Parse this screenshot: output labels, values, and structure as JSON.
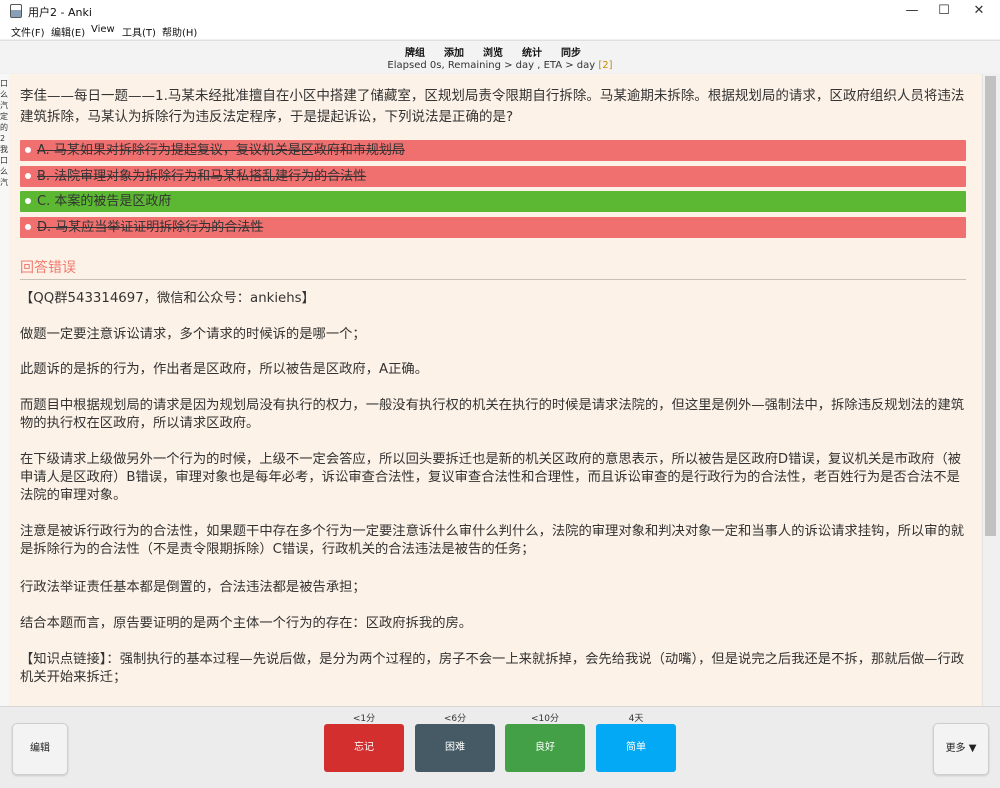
{
  "window": {
    "title": "用户2 - Anki",
    "minimize": "—",
    "maximize": "☐",
    "close": "✕"
  },
  "menu": [
    "文件(F)",
    "编辑(E)",
    "View",
    "工具(T)",
    "帮助(H)"
  ],
  "toolbar": [
    "牌组",
    "添加",
    "浏览",
    "统计",
    "同步"
  ],
  "status": {
    "text": "Elapsed 0s, Remaining > day , ETA > day",
    "badge": "[2]"
  },
  "side_strip_text": "口\n么\n汽\n定\n的\n2\n我\n口\n么\n汽",
  "question": "李佳——每日一题——1.马某未经批准擅自在小区中搭建了储藏室，区规划局责令限期自行拆除。马某逾期未拆除。根据规划局的请求，区政府组织人员将违法建筑拆除，马某认为拆除行为违反法定程序，于是提起诉讼，下列说法是正确的是?",
  "options": [
    {
      "text": "A. 马某如果对拆除行为提起复议，复议机关是区政府和市规划局",
      "state": "wrong"
    },
    {
      "text": "B. 法院审理对象为拆除行为和马某私搭乱建行为的合法性",
      "state": "wrong"
    },
    {
      "text": "C. 本案的被告是区政府",
      "state": "right"
    },
    {
      "text": "D. 马某应当举证证明拆除行为的合法性",
      "state": "wrong"
    }
  ],
  "result": "回答错误",
  "explanation": [
    "【QQ群543314697，微信和公众号：ankiehs】",
    "做题一定要注意诉讼请求，多个请求的时候诉的是哪一个；",
    "此题诉的是拆的行为，作出者是区政府，所以被告是区政府，A正确。",
    "而题目中根据规划局的请求是因为规划局没有执行的权力，一般没有执行权的机关在执行的时候是请求法院的，但这里是例外—强制法中，拆除违反规划法的建筑物的执行权在区政府，所以请求区政府。",
    "在下级请求上级做另外一个行为的时候，上级不一定会答应，所以回头要拆迁也是新的机关区政府的意思表示，所以被告是区政府D错误，复议机关是市政府（被申请人是区政府）B错误，审理对象也是每年必考，诉讼审查合法性，复议审查合法性和合理性，而且诉讼审查的是行政行为的合法性，老百姓行为是否合法不是法院的审理对象。",
    "注意是被诉行政行为的合法性，如果题干中存在多个行为一定要注意诉什么审什么判什么，法院的审理对象和判决对象一定和当事人的诉讼请求挂钩，所以审的就是拆除行为的合法性（不是责令限期拆除）C错误，行政机关的合法违法是被告的任务；",
    "行政法举证责任基本都是倒置的，合法违法都是被告承担；",
    "结合本题而言，原告要证明的是两个主体一个行为的存在：区政府拆我的房。",
    "【知识点链接】：强制执行的基本过程—先说后做，是分为两个过程的，房子不会一上来就拆掉，会先给我说（动嘴），但是说完之后我还是不拆，那就后做—行政机关开始来拆迁；"
  ],
  "bottom": {
    "edit": "编辑",
    "more": "更多 ▼",
    "buttons": [
      {
        "label": "忘记",
        "time": "<1分",
        "color": "#d32f2f"
      },
      {
        "label": "困难",
        "time": "<6分",
        "color": "#455a64"
      },
      {
        "label": "良好",
        "time": "<10分",
        "color": "#43a047"
      },
      {
        "label": "简单",
        "time": "4天",
        "color": "#03a9f4"
      }
    ]
  }
}
